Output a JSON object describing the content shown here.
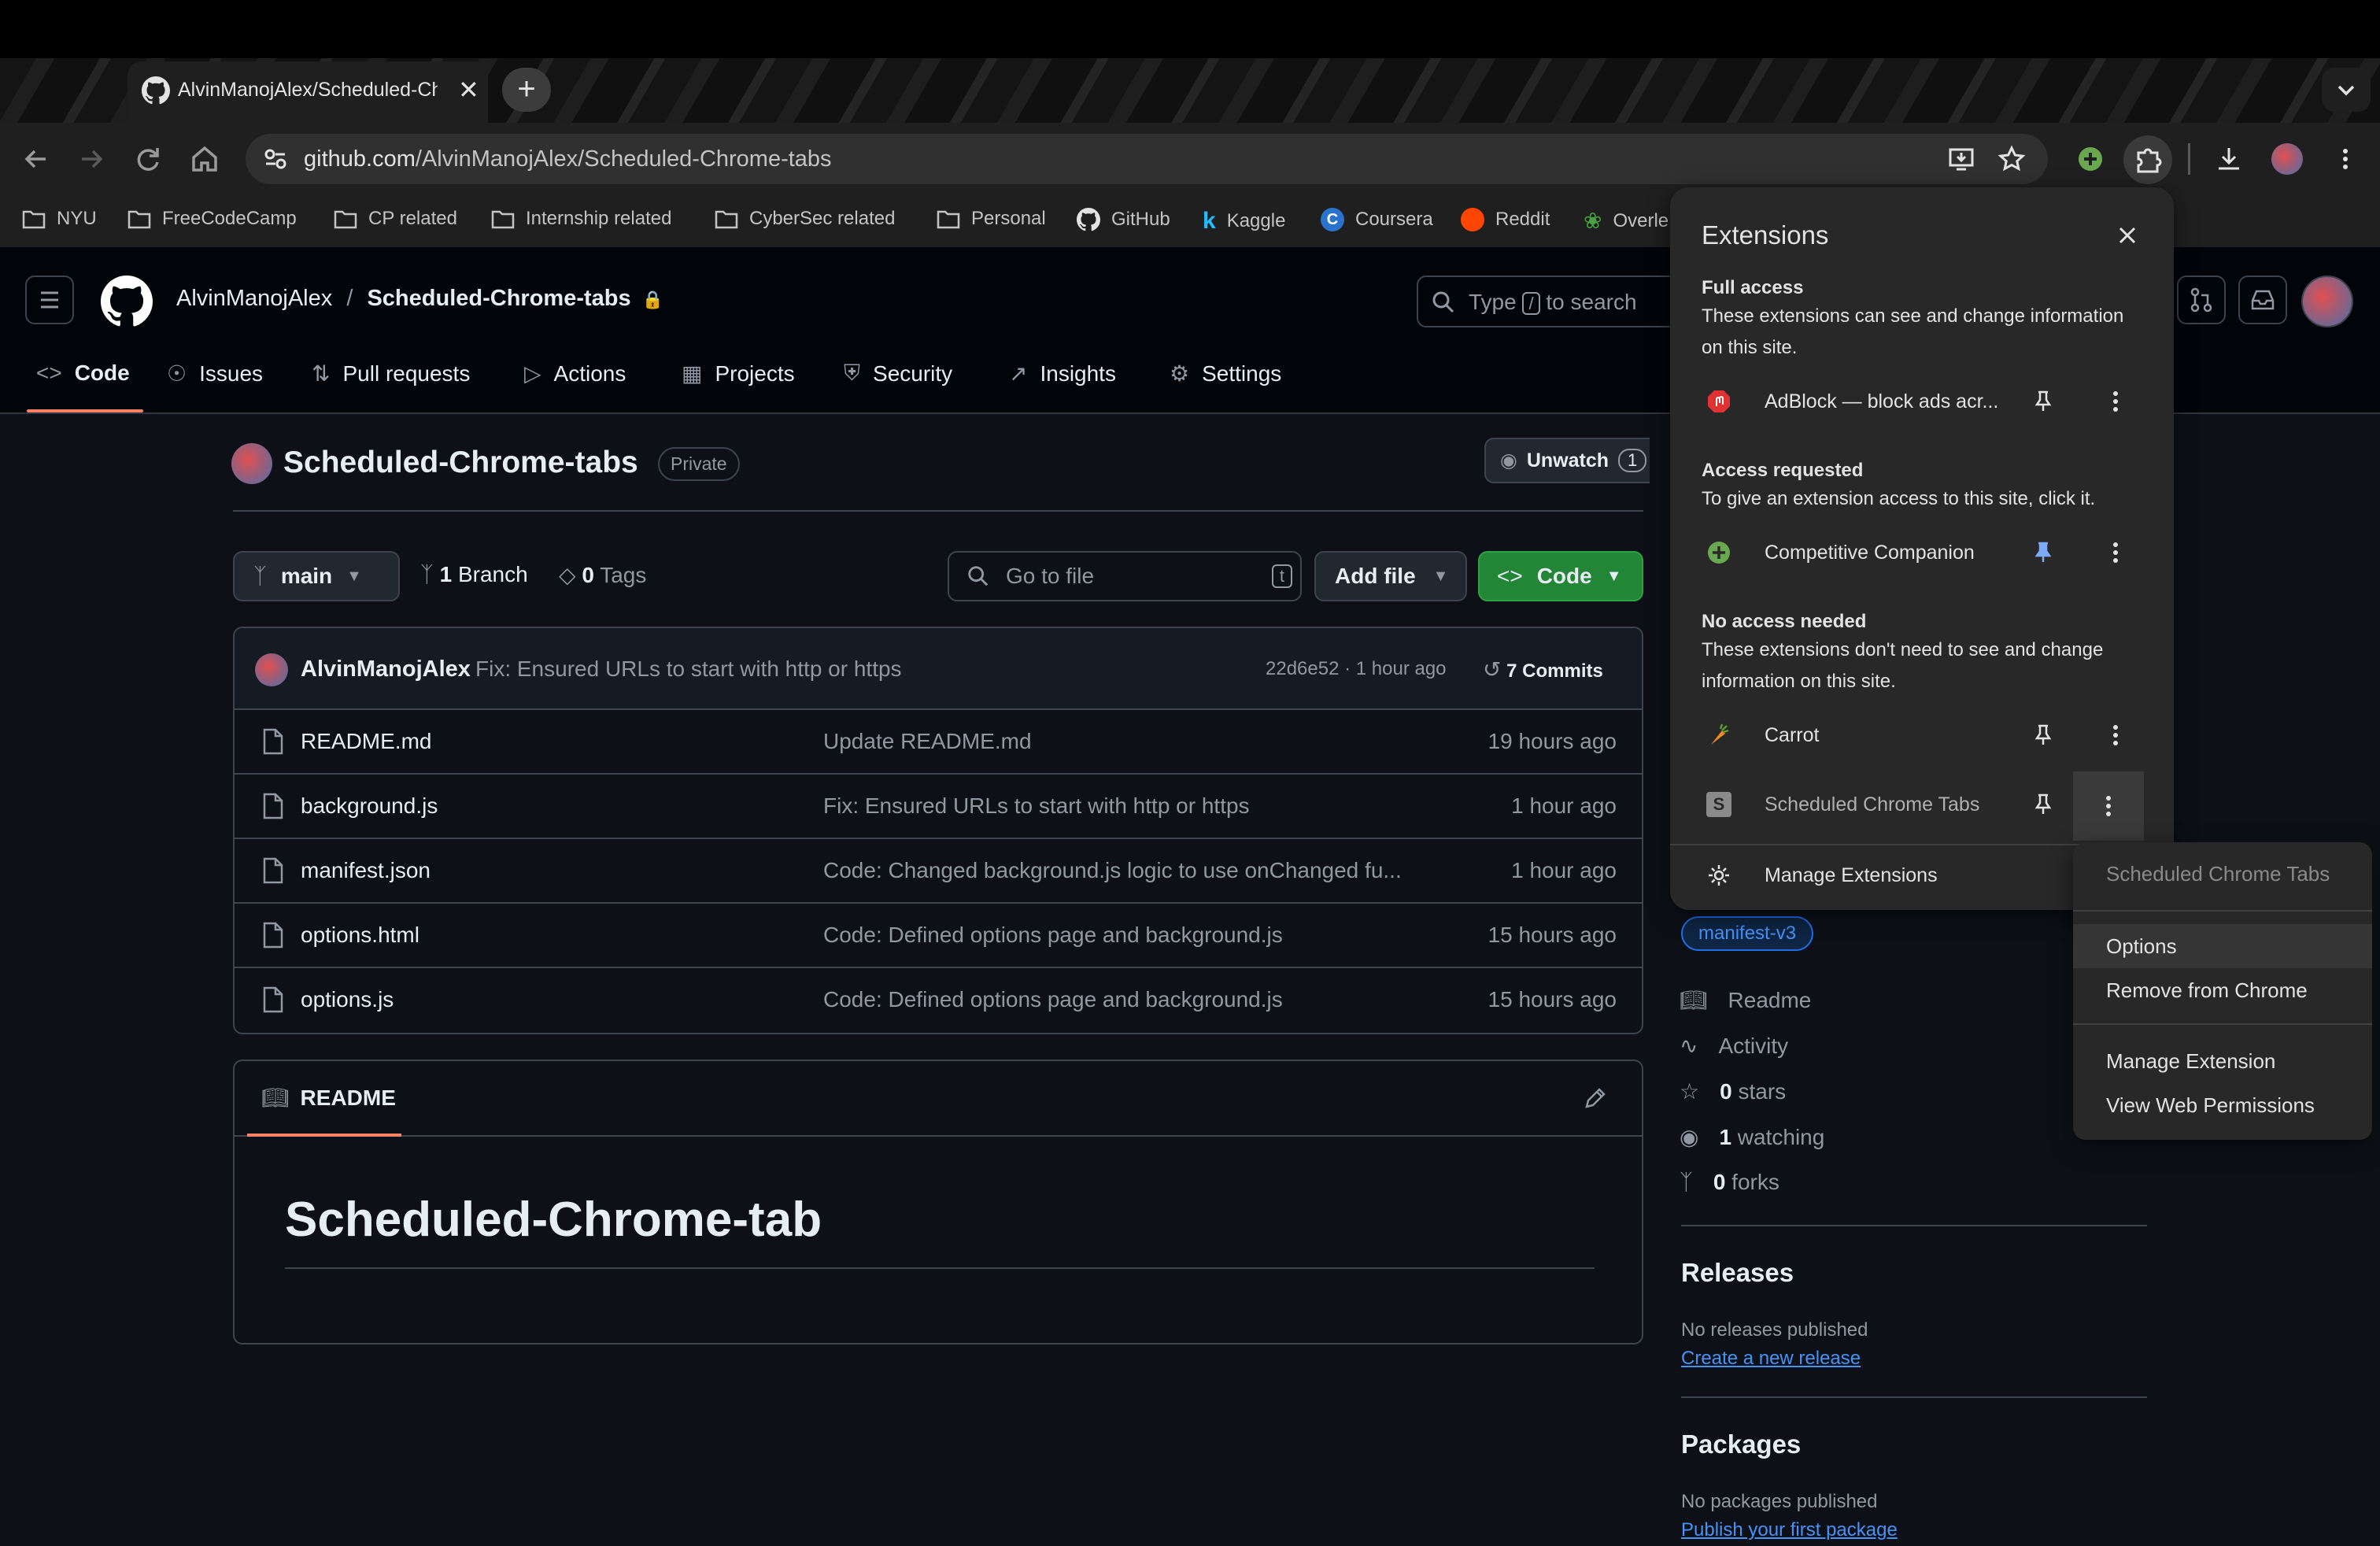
{
  "browser": {
    "tab_title": "AlvinManojAlex/Scheduled-Chrome-tabs",
    "url_host": "github.com",
    "url_path": "/AlvinManojAlex/Scheduled-Chrome-tabs",
    "new_tab": "+",
    "tab_close": "✕"
  },
  "bookmarks": [
    "NYU",
    "FreeCodeCamp",
    "CP related",
    "Internship related",
    "CyberSec related",
    "Personal",
    "GitHub",
    "Kaggle",
    "Coursera",
    "Reddit",
    "Overle"
  ],
  "header": {
    "owner": "AlvinManojAlex",
    "separator": "/",
    "repo": "Scheduled-Chrome-tabs",
    "search_type": "Type",
    "search_key": "/",
    "search_rest": "to search"
  },
  "nav_tabs": [
    "Code",
    "Issues",
    "Pull requests",
    "Actions",
    "Projects",
    "Security",
    "Insights",
    "Settings"
  ],
  "repo": {
    "name": "Scheduled-Chrome-tabs",
    "visibility": "Private",
    "unwatch_label": "Unwatch",
    "watch_count": "1",
    "branch": "main",
    "branch_count": "1",
    "branch_label": "Branch",
    "tag_count": "0",
    "tag_label": "Tags",
    "goto_placeholder": "Go to file",
    "goto_key": "t",
    "add_file": "Add file",
    "code_button": "Code"
  },
  "latest_commit": {
    "author": "AlvinManojAlex",
    "message": "Fix: Ensured URLs to start with http or https",
    "meta": "22d6e52 · 1 hour ago",
    "commits_count": "7",
    "commits_label": "Commits"
  },
  "files": [
    {
      "name": "README.md",
      "message": "Update README.md",
      "time": "19 hours ago"
    },
    {
      "name": "background.js",
      "message": "Fix: Ensured URLs to start with http or https",
      "time": "1 hour ago"
    },
    {
      "name": "manifest.json",
      "message": "Code: Changed background.js logic to use onChanged fu...",
      "time": "1 hour ago"
    },
    {
      "name": "options.html",
      "message": "Code: Defined options page and background.js",
      "time": "15 hours ago"
    },
    {
      "name": "options.js",
      "message": "Code: Defined options page and background.js",
      "time": "15 hours ago"
    }
  ],
  "readme": {
    "tab_label": "README",
    "heading": "Scheduled-Chrome-tab"
  },
  "sidebar": {
    "topic": "manifest-v3",
    "links": [
      {
        "label": "Readme",
        "icon": "book-icon"
      },
      {
        "label": "Activity",
        "icon": "pulse-icon"
      },
      {
        "count": "0",
        "label": "stars",
        "icon": "star-icon"
      },
      {
        "count": "1",
        "label": "watching",
        "icon": "eye-icon"
      },
      {
        "count": "0",
        "label": "forks",
        "icon": "fork-icon"
      }
    ],
    "releases_title": "Releases",
    "releases_text": "No releases published",
    "releases_link": "Create a new release",
    "packages_title": "Packages",
    "packages_text": "No packages published",
    "packages_link": "Publish your first package"
  },
  "extensions_popup": {
    "title": "Extensions",
    "full_access_title": "Full access",
    "full_access_desc": "These extensions can see and change information on this site.",
    "access_requested_title": "Access requested",
    "access_requested_desc": "To give an extension access to this site, click it.",
    "no_access_title": "No access needed",
    "no_access_desc": "These extensions don't need to see and change information on this site.",
    "items": {
      "adblock": "AdBlock — block ads acr...",
      "competitive": "Competitive Companion",
      "carrot": "Carrot",
      "scheduled": "Scheduled Chrome Tabs"
    },
    "manage": "Manage Extensions"
  },
  "context_menu": {
    "header": "Scheduled Chrome Tabs",
    "items": [
      "Options",
      "Remove from Chrome",
      "Manage Extension",
      "View Web Permissions"
    ]
  },
  "colors": {
    "accent_green": "#238636",
    "link_blue": "#4493f8",
    "tab_underline": "#f78166",
    "pinned_blue": "#7cacf8"
  }
}
